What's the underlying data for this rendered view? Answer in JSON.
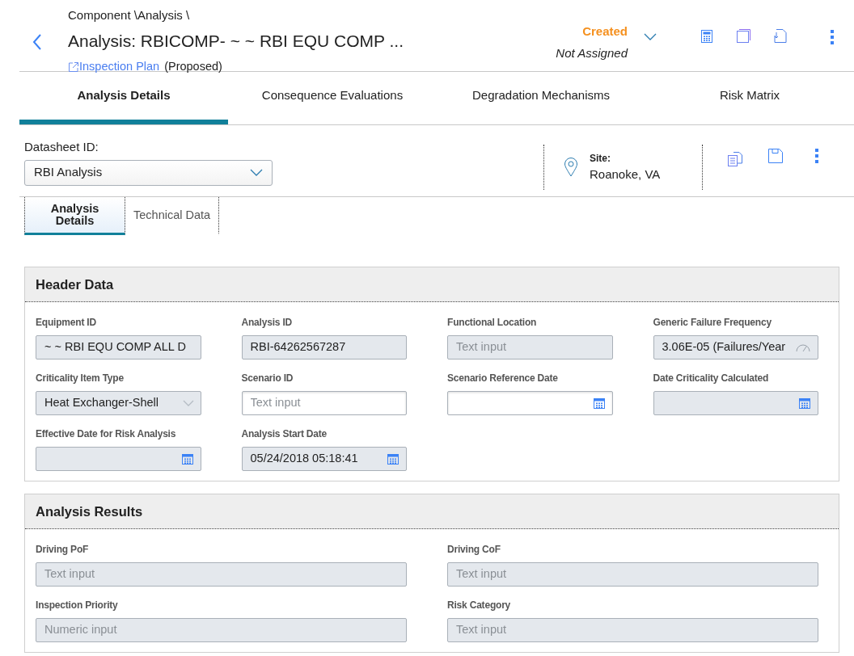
{
  "breadcrumb": "Component \\Analysis \\",
  "title": "Analysis: RBICOMP- ~ ~ RBI EQU COMP ...",
  "link": {
    "label": "Inspection Plan",
    "note": "(Proposed)"
  },
  "status": {
    "state": "Created",
    "assignee": "Not Assigned"
  },
  "tabs": [
    {
      "label": "Analysis Details",
      "selected": true
    },
    {
      "label": "Consequence Evaluations",
      "selected": false
    },
    {
      "label": "Degradation Mechanisms",
      "selected": false
    },
    {
      "label": "Risk Matrix",
      "selected": false
    }
  ],
  "datasheet": {
    "label": "Datasheet ID:",
    "value": "RBI Analysis"
  },
  "site": {
    "label": "Site:",
    "value": "Roanoke, VA"
  },
  "subtabs": [
    {
      "label": "Analysis Details",
      "selected": true
    },
    {
      "label": "Technical Data",
      "selected": false
    }
  ],
  "sections": [
    {
      "title": "Header Data",
      "kind": "four-column",
      "fields": [
        {
          "label": "Equipment ID",
          "kind": "text",
          "disabled": true,
          "value": "~  ~ RBI EQU COMP ALL D"
        },
        {
          "label": "Analysis ID",
          "kind": "text",
          "disabled": true,
          "value": "RBI-64262567287"
        },
        {
          "label": "Functional Location",
          "kind": "text",
          "disabled": true,
          "placeholder": "Text input"
        },
        {
          "label": "Generic Failure Frequency",
          "kind": "unit",
          "disabled": true,
          "value": "3.06E-05 (Failures/Year"
        },
        {
          "label": "Criticality Item Type",
          "kind": "select",
          "disabled": true,
          "value": "Heat Exchanger-Shell"
        },
        {
          "label": "Scenario ID",
          "kind": "text",
          "disabled": false,
          "placeholder": "Text input"
        },
        {
          "label": "Scenario Reference Date",
          "kind": "date",
          "disabled": false
        },
        {
          "label": "Date Criticality Calculated",
          "kind": "date",
          "disabled": true
        },
        {
          "label": "Effective Date for Risk Analysis",
          "kind": "date",
          "disabled": true
        },
        {
          "label": "Analysis Start Date",
          "kind": "date",
          "disabled": true,
          "value": "05/24/2018 05:18:41"
        }
      ]
    },
    {
      "title": "Analysis Results",
      "kind": "two-column",
      "fields": [
        {
          "label": "Driving PoF",
          "kind": "text",
          "disabled": true,
          "placeholder": "Text input"
        },
        {
          "label": "Driving CoF",
          "kind": "text",
          "disabled": true,
          "placeholder": "Text input"
        },
        {
          "label": "Inspection Priority",
          "kind": "text",
          "disabled": true,
          "placeholder": "Numeric input"
        },
        {
          "label": "Risk Category",
          "kind": "text",
          "disabled": true,
          "placeholder": "Text input"
        }
      ]
    }
  ]
}
